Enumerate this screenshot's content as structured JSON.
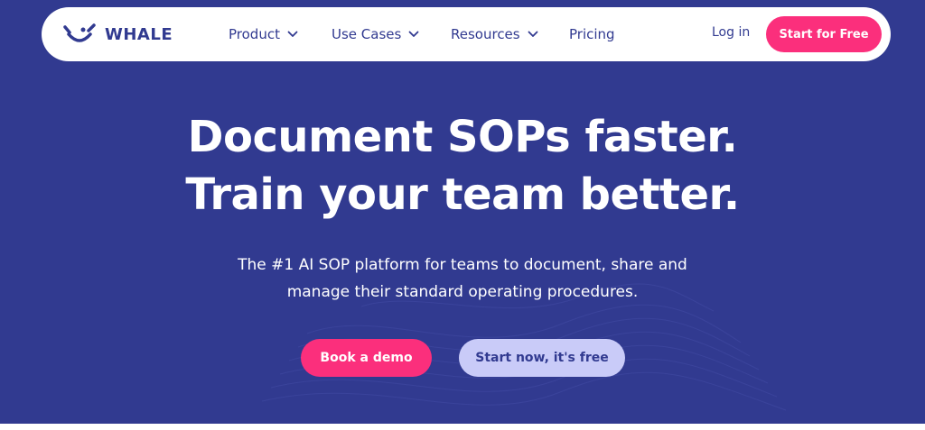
{
  "brand": {
    "name": "WHALE",
    "logo_icon": "whale-smile-icon"
  },
  "nav": {
    "items": [
      {
        "label": "Product",
        "has_dropdown": true
      },
      {
        "label": "Use Cases",
        "has_dropdown": true
      },
      {
        "label": "Resources",
        "has_dropdown": true
      },
      {
        "label": "Pricing",
        "has_dropdown": false
      }
    ],
    "login_label": "Log in",
    "cta_label": "Start for Free"
  },
  "hero": {
    "headline_line1": "Document SOPs faster.",
    "headline_line2": "Train your team better.",
    "subtitle_line1": "The #1 AI SOP platform for teams to document, share and",
    "subtitle_line2": "manage their standard operating procedures.",
    "primary_button": "Book a demo",
    "secondary_button": "Start now, it's free"
  },
  "colors": {
    "background": "#313a90",
    "accent_pink": "#fb2f7c",
    "secondary_button_bg": "#c9cbf8",
    "text_on_dark": "#ffffff",
    "navbar_bg": "#ffffff"
  }
}
